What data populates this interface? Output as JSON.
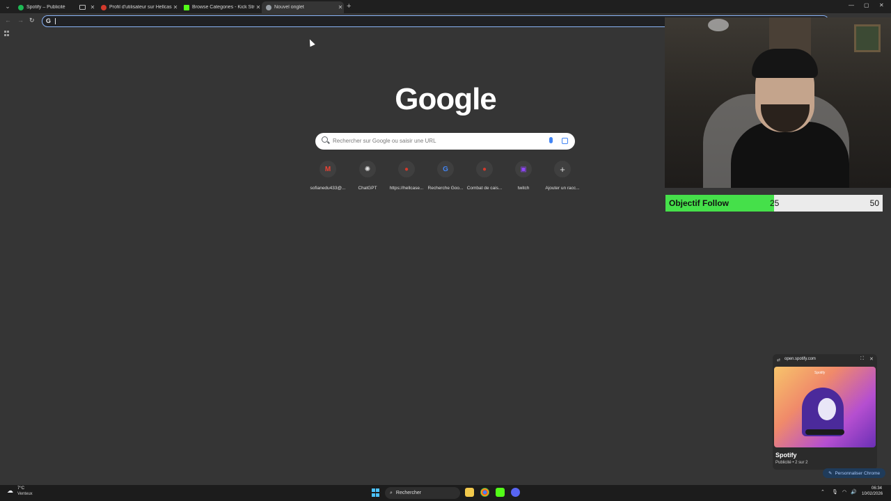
{
  "browser": {
    "tabs": [
      {
        "title": "Spotify – Publicité",
        "favicon_color": "#1db954",
        "active": false
      },
      {
        "title": "Profil d'utilisateur sur Hellcase",
        "favicon_color": "#d33a2c",
        "active": false
      },
      {
        "title": "Browse Categories - Kick Stream",
        "favicon_color": "#53fc18",
        "active": false
      },
      {
        "title": "Nouvel onglet",
        "favicon_color": "#9aa0a6",
        "active": true
      }
    ],
    "new_tab_label": "+",
    "window_controls": {
      "minimize": "—",
      "maximize": "▢",
      "close": "✕"
    },
    "omnibox_value": ""
  },
  "ntp": {
    "logo": "Google",
    "search_placeholder": "Rechercher sur Google ou saisir une URL",
    "shortcuts": [
      {
        "label": "sofianedu433@...",
        "icon": "gmail-icon",
        "glyph": "M",
        "color": "#ea4335"
      },
      {
        "label": "ChatGPT",
        "icon": "chatgpt-icon",
        "glyph": "✺",
        "color": "#e0e0e0"
      },
      {
        "label": "https://hellcase...",
        "icon": "hellcase-icon",
        "glyph": "●",
        "color": "#d33a2c"
      },
      {
        "label": "Recherche Goo...",
        "icon": "google-icon",
        "glyph": "G",
        "color": "#4285f4"
      },
      {
        "label": "Combat de cais...",
        "icon": "hellcase-icon",
        "glyph": "●",
        "color": "#d33a2c"
      },
      {
        "label": "twitch",
        "icon": "twitch-icon",
        "glyph": "▣",
        "color": "#9146ff"
      },
      {
        "label": "Ajouter un racc...",
        "icon": "plus-icon",
        "glyph": "+",
        "color": "#e0e0e0"
      }
    ]
  },
  "stream_overlay": {
    "goal_label": "Objectif Follow",
    "goal_current": "25",
    "goal_max": "50",
    "goal_fraction": 0.5,
    "goal_color": "#45e04a"
  },
  "pip": {
    "url": "open.spotify.com",
    "art_brand": "Spotify",
    "title": "Spotify",
    "subtitle": "Publicité • 2 sur 2"
  },
  "customize_label": "Personnaliser Chrome",
  "taskbar": {
    "weather_temp": "7°C",
    "weather_desc": "Venteux",
    "search_label": "Rechercher",
    "time": "06:34",
    "date": "10/02/2026"
  }
}
